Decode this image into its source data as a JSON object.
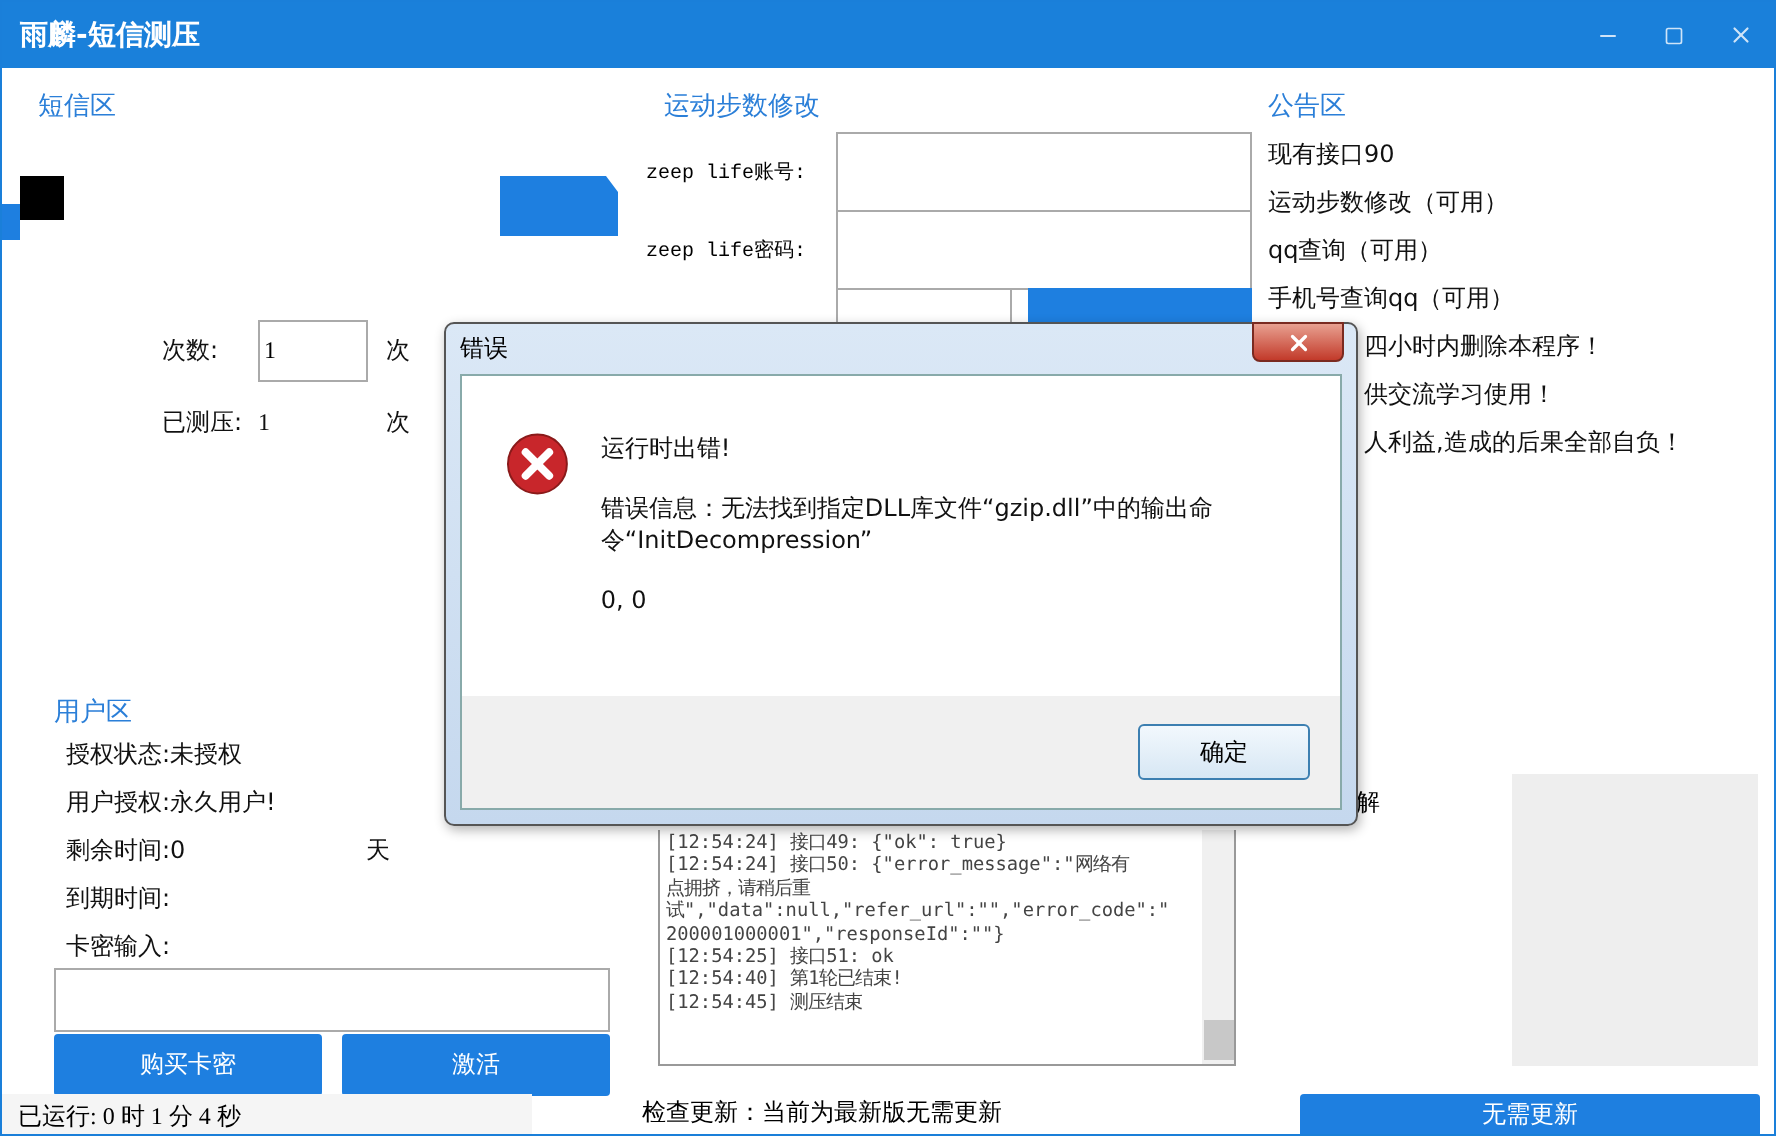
{
  "window": {
    "title": "雨麟-短信测压"
  },
  "sms": {
    "title": "短信区",
    "count_label": "次数:",
    "count_value": "1",
    "count_unit": "次",
    "done_label": "已测压:",
    "done_value": "1",
    "done_unit": "次"
  },
  "steps": {
    "title": "运动步数修改",
    "fields": [
      {
        "label": "zeep life账号:"
      },
      {
        "label": "zeep life密码:"
      }
    ]
  },
  "notice": {
    "title": "公告区",
    "lines": [
      {
        "text": "现有接口90",
        "kind": "full"
      },
      {
        "text": "运动步数修改（可用）",
        "kind": "full"
      },
      {
        "text": "qq查询（可用）",
        "kind": "full"
      },
      {
        "text": "手机号查询qq（可用）",
        "kind": "full"
      },
      {
        "text": "四小时内删除本程序！",
        "kind": "clipped"
      },
      {
        "text": "供交流学习使用！",
        "kind": "clipped"
      },
      {
        "text": "人利益,造成的后果全部自负！",
        "kind": "clipped"
      }
    ]
  },
  "user": {
    "title": "用户区",
    "lines": [
      "授权状态:未授权",
      "用户授权:永久用户!",
      "剩余时间:0",
      "到期时间:",
      "卡密输入:"
    ],
    "remaining_unit": "天",
    "buttons": [
      "购买卡密",
      "激活"
    ]
  },
  "log": {
    "lines": [
      "[12:54:24] 接口49: {\"ok\": true}",
      "[12:54:24] 接口50: {\"error_message\":\"网络有",
      "点拥挤，请稍后重",
      "试\",\"data\":null,\"refer_url\":\"\",\"error_code\":\"",
      "200001000001\",\"responseId\":\"\"}",
      "[12:54:25] 接口51: ok",
      "[12:54:40] 第1轮已结束!",
      "[12:54:45] 测压结束"
    ]
  },
  "right_panel": {
    "text": "解"
  },
  "status_bar": {
    "runtime": "已运行: 0 时 1 分 4 秒",
    "update": "检查更新：当前为最新版无需更新",
    "button": "无需更新"
  },
  "dialog": {
    "title": "错误",
    "heading": "运行时出错!",
    "message": "错误信息：无法找到指定DLL库文件“gzip.dll”中的输出命令“InitDecompression”",
    "code": "0, 0",
    "button": "确定"
  }
}
